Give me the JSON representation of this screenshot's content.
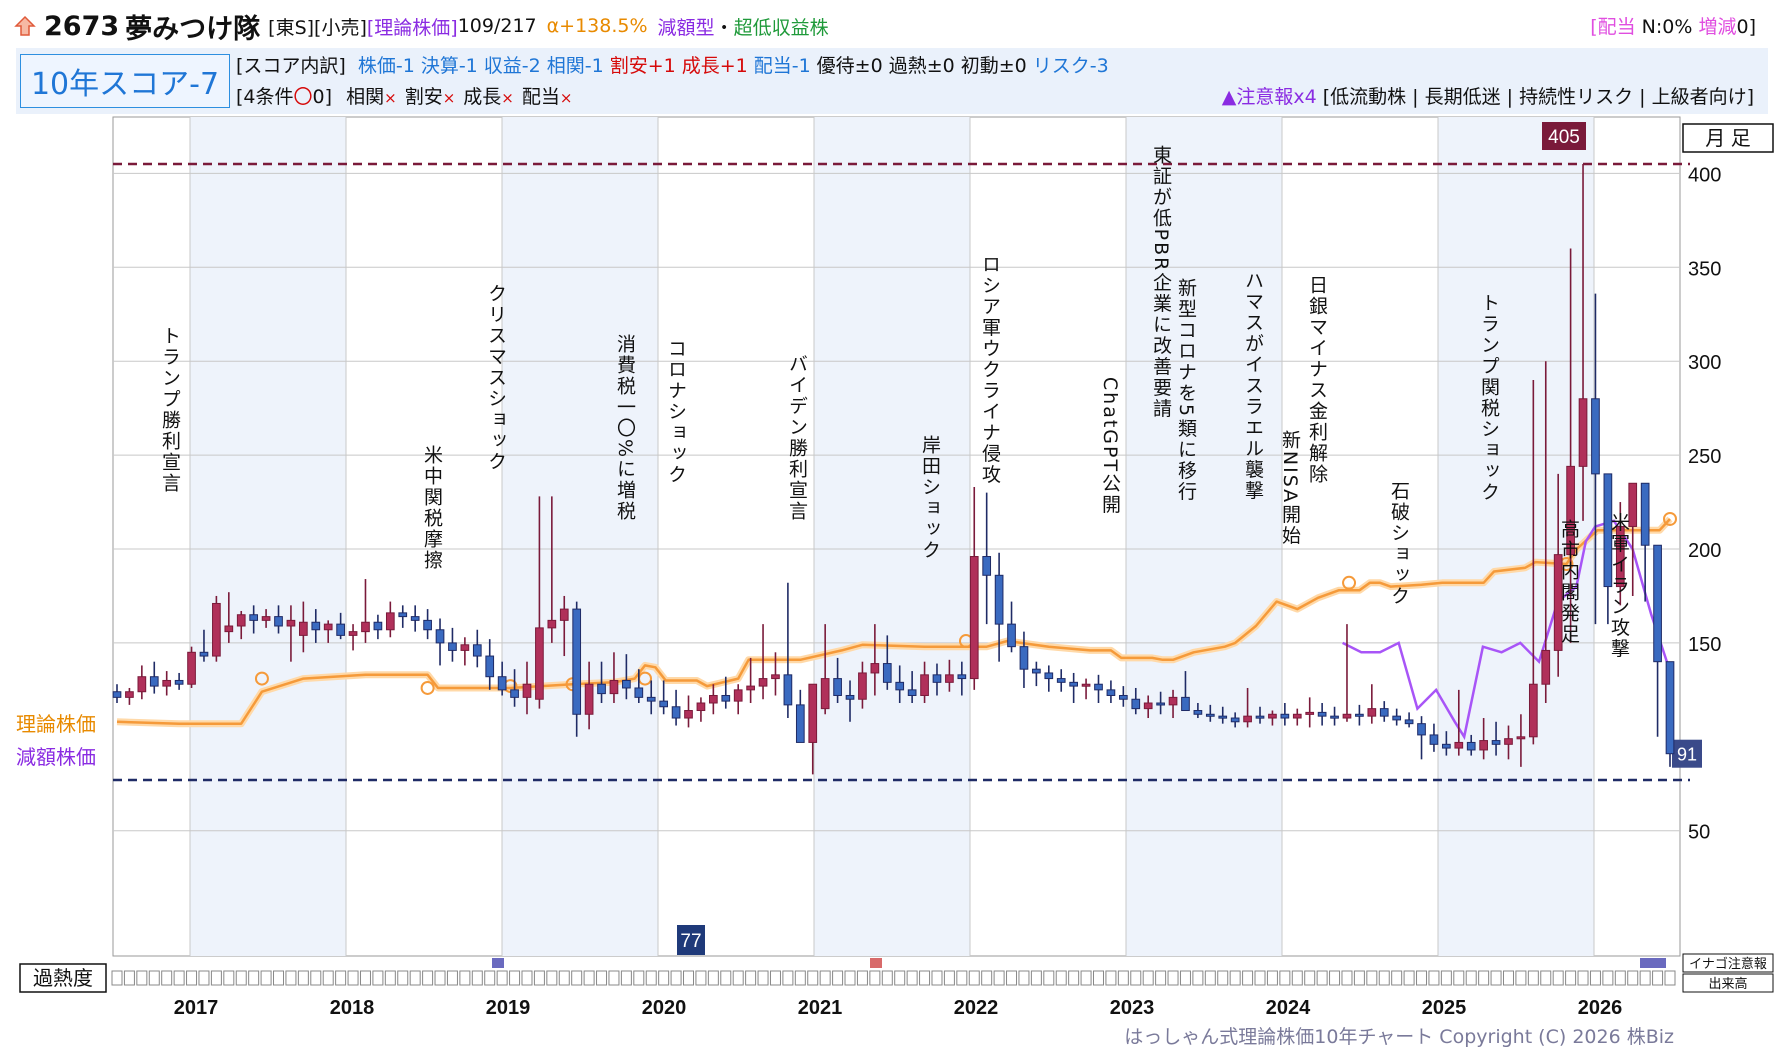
{
  "header": {
    "code": "2673",
    "name": "夢みつけ隊",
    "market": "[東S][小売]",
    "theory_label": "[理論株価]",
    "ranks": "109/217",
    "alpha": "α+138.5%",
    "type1": "減額型",
    "sep": "・",
    "type2": "超低収益株",
    "dividend_open": "[",
    "dividend_label": "配当",
    "dividend_value": " N:0%",
    "div_change_label": " 増減",
    "div_change_value": "0]",
    "score_label": "10年スコア-7",
    "breakdown": {
      "head": "[スコア内訳]",
      "items": [
        {
          "text": "株価-1",
          "color": "#1f76d6"
        },
        {
          "text": "決算-1",
          "color": "#1f76d6"
        },
        {
          "text": "収益-2",
          "color": "#1f76d6"
        },
        {
          "text": "相関-1",
          "color": "#1f76d6"
        },
        {
          "text": "割安+1",
          "color": "#d60a0a"
        },
        {
          "text": "成長+1",
          "color": "#d60a0a"
        },
        {
          "text": "配当-1",
          "color": "#1f76d6"
        },
        {
          "text": "優待±0",
          "color": "#111111"
        },
        {
          "text": "過熱±0",
          "color": "#111111"
        },
        {
          "text": "初動±0",
          "color": "#111111"
        },
        {
          "text": "リスク-3",
          "color": "#1f76d6"
        }
      ]
    },
    "conditions": {
      "head": "[4条件",
      "circle": "〇",
      "count": "0]",
      "items": [
        "相関",
        "割安",
        "成長",
        "配当"
      ],
      "mark": "×"
    },
    "warning": {
      "head": "▲注意報x4",
      "body": " [低流動株 | 長期低迷 | 持続性リスク | 上級者向け]"
    }
  },
  "legend": {
    "theory": "理論株価",
    "reduced": "減額株価",
    "period": "月 足",
    "heat": "過熱度",
    "inago": "イナゴ注意報",
    "volume": "出来高"
  },
  "copyright": "はっしゃん式理論株価10年チャート Copyright (C) 2026 株Biz",
  "chart_data": {
    "type": "candlestick",
    "ylim": [
      0,
      420
    ],
    "yticks": [
      50,
      150,
      200,
      250,
      300,
      350,
      400
    ],
    "years": [
      "2017",
      "2018",
      "2019",
      "2020",
      "2021",
      "2022",
      "2023",
      "2024",
      "2025",
      "2026"
    ],
    "high_marker": 405,
    "low_marker": 77,
    "last_price": 91,
    "events": [
      {
        "text": "トランプ勝利宣言",
        "month": 1
      },
      {
        "text": "米中関税摩擦",
        "month": 22
      },
      {
        "text": "クリスマスショック",
        "month": 27
      },
      {
        "text": "消費税一〇%に増税",
        "month": 37
      },
      {
        "text": "コロナショック",
        "month": 39
      },
      {
        "text": "バイデン勝利宣言",
        "month": 47
      },
      {
        "text": "岸田ショック",
        "month": 58
      },
      {
        "text": "ロシア軍ウクライナ侵攻",
        "month": 62
      },
      {
        "text": "ChatGPT公開",
        "month": 73
      },
      {
        "text": "東証が低PBR企業に改善要請",
        "month": 77
      },
      {
        "text": "新型コロナを5類に移行",
        "month": 79
      },
      {
        "text": "ハマスがイスラエル襲撃",
        "month": 85
      },
      {
        "text": "新NISA開始",
        "month": 88
      },
      {
        "text": "日銀マイナス金利解除",
        "month": 90
      },
      {
        "text": "石破ショック",
        "month": 96
      },
      {
        "text": "トランプ関税ショック",
        "month": 102
      },
      {
        "text": "高市内閣発足",
        "month": 109
      },
      {
        "text": "米軍イラン攻撃",
        "month": 113
      }
    ],
    "candles": [
      [
        124,
        128,
        118,
        121
      ],
      [
        121,
        126,
        117,
        124
      ],
      [
        124,
        138,
        120,
        132
      ],
      [
        132,
        140,
        123,
        127
      ],
      [
        127,
        135,
        122,
        130
      ],
      [
        130,
        134,
        125,
        128
      ],
      [
        128,
        148,
        126,
        145
      ],
      [
        145,
        157,
        140,
        143
      ],
      [
        143,
        175,
        140,
        171
      ],
      [
        156,
        177,
        150,
        159
      ],
      [
        159,
        167,
        152,
        165
      ],
      [
        165,
        170,
        155,
        162
      ],
      [
        162,
        168,
        158,
        164
      ],
      [
        164,
        170,
        155,
        159
      ],
      [
        159,
        170,
        140,
        162
      ],
      [
        154,
        172,
        145,
        161
      ],
      [
        161,
        168,
        150,
        157
      ],
      [
        157,
        162,
        150,
        160
      ],
      [
        160,
        166,
        152,
        154
      ],
      [
        154,
        160,
        146,
        156
      ],
      [
        156,
        184,
        150,
        161
      ],
      [
        161,
        165,
        152,
        157
      ],
      [
        157,
        172,
        153,
        166
      ],
      [
        166,
        170,
        158,
        164
      ],
      [
        164,
        170,
        156,
        162
      ],
      [
        162,
        168,
        152,
        157
      ],
      [
        157,
        163,
        138,
        150
      ],
      [
        150,
        158,
        140,
        146
      ],
      [
        146,
        153,
        138,
        149
      ],
      [
        149,
        157,
        137,
        143
      ],
      [
        143,
        152,
        125,
        132
      ],
      [
        132,
        140,
        122,
        125
      ],
      [
        125,
        136,
        116,
        121
      ],
      [
        121,
        140,
        112,
        128
      ],
      [
        120,
        228,
        115,
        158
      ],
      [
        158,
        228,
        150,
        162
      ],
      [
        162,
        175,
        143,
        168
      ],
      [
        168,
        172,
        100,
        112
      ],
      [
        112,
        140,
        104,
        128
      ],
      [
        128,
        140,
        118,
        123
      ],
      [
        123,
        145,
        118,
        130
      ],
      [
        130,
        144,
        120,
        126
      ],
      [
        126,
        136,
        118,
        121
      ],
      [
        121,
        130,
        112,
        119
      ],
      [
        119,
        130,
        112,
        116
      ],
      [
        116,
        125,
        106,
        110
      ],
      [
        110,
        122,
        105,
        114
      ],
      [
        114,
        121,
        108,
        118
      ],
      [
        118,
        128,
        112,
        122
      ],
      [
        122,
        132,
        115,
        119
      ],
      [
        119,
        128,
        112,
        125
      ],
      [
        125,
        142,
        118,
        127
      ],
      [
        127,
        160,
        120,
        131
      ],
      [
        131,
        145,
        122,
        133
      ],
      [
        133,
        182,
        110,
        117
      ],
      [
        117,
        125,
        103,
        97
      ],
      [
        97,
        122,
        80,
        128
      ],
      [
        115,
        160,
        112,
        131
      ],
      [
        131,
        142,
        118,
        122
      ],
      [
        122,
        130,
        108,
        120
      ],
      [
        120,
        140,
        115,
        134
      ],
      [
        134,
        160,
        122,
        139
      ],
      [
        139,
        154,
        125,
        129
      ],
      [
        129,
        138,
        118,
        125
      ],
      [
        125,
        135,
        118,
        122
      ],
      [
        122,
        140,
        118,
        133
      ],
      [
        133,
        139,
        122,
        129
      ],
      [
        129,
        141,
        124,
        133
      ],
      [
        133,
        140,
        122,
        131
      ],
      [
        131,
        233,
        125,
        196
      ],
      [
        196,
        230,
        160,
        186
      ],
      [
        186,
        198,
        140,
        160
      ],
      [
        160,
        172,
        145,
        148
      ],
      [
        148,
        156,
        126,
        136
      ],
      [
        136,
        140,
        127,
        134
      ],
      [
        134,
        138,
        124,
        131
      ],
      [
        131,
        136,
        124,
        129
      ],
      [
        129,
        134,
        118,
        127
      ],
      [
        127,
        131,
        120,
        128
      ],
      [
        128,
        133,
        118,
        125
      ],
      [
        125,
        130,
        118,
        122
      ],
      [
        122,
        127,
        116,
        120
      ],
      [
        120,
        126,
        112,
        115
      ],
      [
        115,
        122,
        110,
        118
      ],
      [
        118,
        124,
        112,
        117
      ],
      [
        117,
        125,
        110,
        121
      ],
      [
        121,
        135,
        115,
        114
      ],
      [
        114,
        118,
        110,
        112
      ],
      [
        112,
        117,
        108,
        111
      ],
      [
        111,
        116,
        107,
        110
      ],
      [
        110,
        113,
        105,
        108
      ],
      [
        108,
        126,
        105,
        111
      ],
      [
        111,
        116,
        107,
        110
      ],
      [
        110,
        114,
        106,
        112
      ],
      [
        112,
        118,
        106,
        110
      ],
      [
        110,
        115,
        106,
        112
      ],
      [
        112,
        121,
        105,
        113
      ],
      [
        113,
        118,
        106,
        111
      ],
      [
        111,
        116,
        106,
        110
      ],
      [
        110,
        160,
        108,
        112
      ],
      [
        112,
        117,
        106,
        111
      ],
      [
        111,
        128,
        107,
        115
      ],
      [
        115,
        119,
        108,
        111
      ],
      [
        111,
        115,
        106,
        109
      ],
      [
        109,
        113,
        105,
        107
      ],
      [
        107,
        111,
        88,
        101
      ],
      [
        101,
        107,
        92,
        96
      ],
      [
        96,
        103,
        90,
        94
      ],
      [
        94,
        125,
        90,
        97
      ],
      [
        97,
        101,
        90,
        93
      ],
      [
        93,
        110,
        88,
        98
      ],
      [
        98,
        108,
        90,
        96
      ],
      [
        96,
        106,
        88,
        99
      ],
      [
        99,
        112,
        84,
        100
      ],
      [
        100,
        290,
        96,
        128
      ],
      [
        128,
        300,
        118,
        146
      ],
      [
        146,
        240,
        132,
        197
      ],
      [
        197,
        360,
        150,
        244
      ],
      [
        244,
        405,
        215,
        280
      ],
      [
        280,
        336,
        160,
        240
      ],
      [
        240,
        205,
        160,
        180
      ],
      [
        180,
        225,
        170,
        212
      ],
      [
        212,
        230,
        175,
        235
      ],
      [
        235,
        200,
        172,
        202
      ],
      [
        202,
        165,
        100,
        140
      ],
      [
        140,
        118,
        84,
        91
      ]
    ],
    "theory_line": [
      [
        0,
        108
      ],
      [
        6,
        107
      ],
      [
        12,
        107
      ],
      [
        14,
        124
      ],
      [
        18,
        131
      ],
      [
        24,
        133
      ],
      [
        30,
        133
      ],
      [
        31,
        126
      ],
      [
        36,
        126
      ],
      [
        38,
        126
      ],
      [
        41,
        127
      ],
      [
        44,
        128
      ],
      [
        48,
        129
      ],
      [
        50,
        131
      ],
      [
        51,
        138
      ],
      [
        52,
        137
      ],
      [
        53,
        130
      ],
      [
        56,
        130
      ],
      [
        57,
        127
      ],
      [
        60,
        131
      ],
      [
        61,
        141
      ],
      [
        66,
        141
      ],
      [
        70,
        146
      ],
      [
        72,
        149
      ],
      [
        78,
        148
      ],
      [
        84,
        148
      ],
      [
        86,
        151
      ],
      [
        90,
        148
      ],
      [
        94,
        146
      ],
      [
        96,
        146
      ],
      [
        97,
        142
      ],
      [
        100,
        142
      ],
      [
        101,
        141
      ],
      [
        102,
        141
      ],
      [
        104,
        145
      ],
      [
        107,
        148
      ],
      [
        108,
        150
      ],
      [
        110,
        159
      ],
      [
        112,
        172
      ],
      [
        114,
        168
      ],
      [
        116,
        174
      ],
      [
        118,
        178
      ],
      [
        120,
        178
      ],
      [
        121,
        182
      ],
      [
        122,
        182
      ],
      [
        123,
        180
      ],
      [
        126,
        181
      ],
      [
        128,
        182
      ],
      [
        130,
        182
      ],
      [
        132,
        182
      ],
      [
        133,
        188
      ],
      [
        136,
        190
      ],
      [
        137,
        193
      ],
      [
        140,
        192
      ],
      [
        141,
        200
      ],
      [
        143,
        210
      ],
      [
        148,
        210
      ],
      [
        149,
        210
      ],
      [
        150,
        216
      ]
    ],
    "reduced_line": [
      [
        0,
        108
      ],
      [
        1,
        108
      ],
      [
        2,
        108
      ],
      [
        3,
        108
      ]
    ]
  }
}
